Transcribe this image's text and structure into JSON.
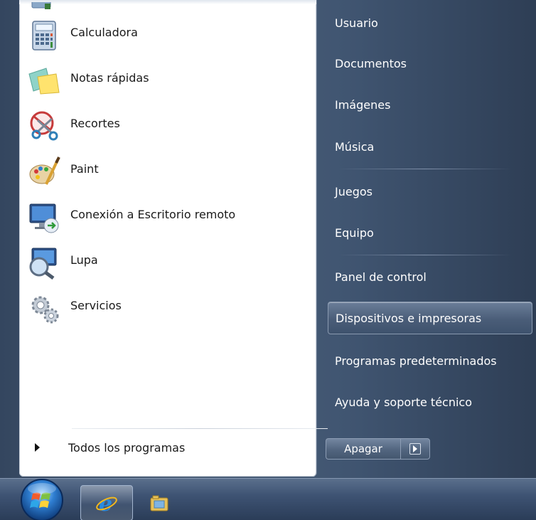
{
  "programs": [
    {
      "label": "Calculadora",
      "icon": "calculator-icon"
    },
    {
      "label": "Notas rápidas",
      "icon": "sticky-notes-icon"
    },
    {
      "label": "Recortes",
      "icon": "snipping-tool-icon"
    },
    {
      "label": "Paint",
      "icon": "paint-icon"
    },
    {
      "label": "Conexión a Escritorio remoto",
      "icon": "remote-desktop-icon"
    },
    {
      "label": "Lupa",
      "icon": "magnifier-icon"
    },
    {
      "label": "Servicios",
      "icon": "services-icon"
    }
  ],
  "all_programs_label": "Todos los programas",
  "right_items": [
    {
      "label": "Usuario"
    },
    {
      "label": "Documentos"
    },
    {
      "label": "Imágenes"
    },
    {
      "label": "Música"
    },
    {
      "label": "Juegos"
    },
    {
      "label": "Equipo"
    },
    {
      "label": "Panel de control"
    },
    {
      "label": "Dispositivos e impresoras",
      "highlighted": true
    },
    {
      "label": "Programas predeterminados"
    },
    {
      "label": "Ayuda y soporte técnico"
    }
  ],
  "shutdown_label": "Apagar",
  "taskbar": {
    "pinned": [
      {
        "icon": "internet-explorer-icon",
        "active": true
      },
      {
        "icon": "folder-library-icon",
        "active": false
      }
    ]
  },
  "colors": {
    "accent_blue": "#3e5373",
    "highlight": "#4a5d78",
    "text_light": "#ffffff",
    "text_dark": "#1a1a1a"
  }
}
